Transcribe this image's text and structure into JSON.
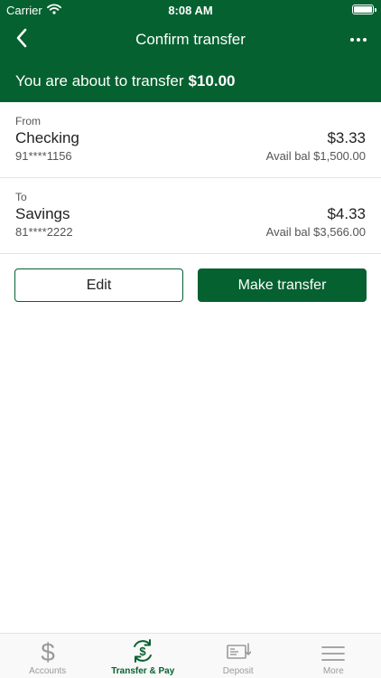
{
  "status_bar": {
    "carrier": "Carrier",
    "time": "8:08 AM"
  },
  "nav": {
    "title": "Confirm transfer",
    "back_icon": "chevron-left-icon",
    "more_icon": "more-horizontal-icon"
  },
  "summary": {
    "prefix": "You are about to transfer",
    "amount": "$10.00"
  },
  "from": {
    "label": "From",
    "name": "Checking",
    "number": "91****1156",
    "balance": "$3.33",
    "avail": "Avail bal $1,500.00"
  },
  "to": {
    "label": "To",
    "name": "Savings",
    "number": "81****2222",
    "balance": "$4.33",
    "avail": "Avail bal $3,566.00"
  },
  "buttons": {
    "edit": "Edit",
    "make": "Make transfer"
  },
  "tabbar": {
    "items": [
      {
        "label": "Accounts",
        "icon": "dollar-icon"
      },
      {
        "label": "Transfer & Pay",
        "icon": "transfer-pay-icon"
      },
      {
        "label": "Deposit",
        "icon": "deposit-check-icon"
      },
      {
        "label": "More",
        "icon": "menu-icon"
      }
    ]
  },
  "colors": {
    "brand_green": "#066130",
    "inactive_gray": "#9a9a9a"
  }
}
